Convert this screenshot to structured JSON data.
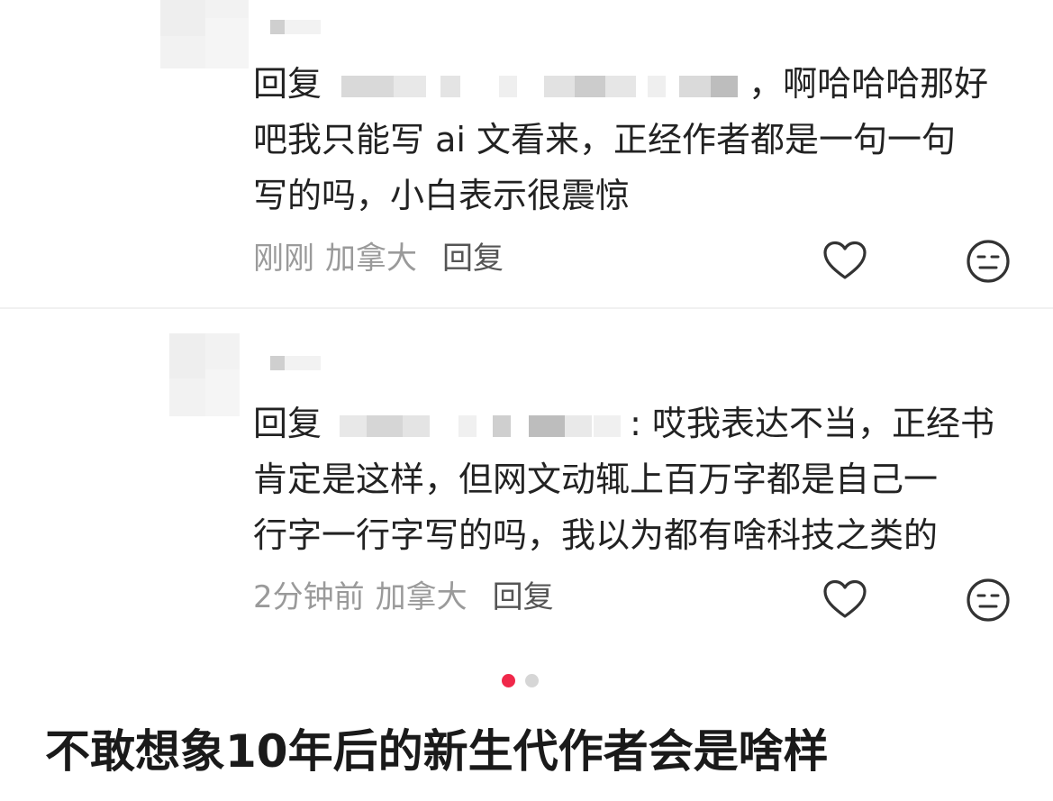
{
  "comments": [
    {
      "reply_prefix": "回复",
      "mention_redacted": true,
      "text_line1": "，啊哈哈哈那好",
      "text_line2": "吧我只能写 ai 文看来，正经作者都是一句一句",
      "text_line3": "写的吗，小白表示很震惊",
      "time": "刚刚",
      "location": "加拿大",
      "reply_label": "回复",
      "like_icon": "heart-outline-icon",
      "dislike_icon": "meh-face-icon"
    },
    {
      "reply_prefix": "回复",
      "mention_redacted": true,
      "text_line1": ": 哎我表达不当，正经书",
      "text_line2": "肯定是这样，但网文动辄上百万字都是自己一",
      "text_line3": "行字一行字写的吗，我以为都有啥科技之类的",
      "time": "2分钟前",
      "location": "加拿大",
      "reply_label": "回复",
      "like_icon": "heart-outline-icon",
      "dislike_icon": "meh-face-icon"
    }
  ],
  "pagination": {
    "total": 2,
    "active": 1,
    "active_color": "#f0284a",
    "inactive_color": "#d6d6d6"
  },
  "caption": "不敢想象10年后的新生代作者会是啥样",
  "colors": {
    "text": "#222222",
    "meta": "#9a9a9a",
    "icon": "#333333"
  }
}
